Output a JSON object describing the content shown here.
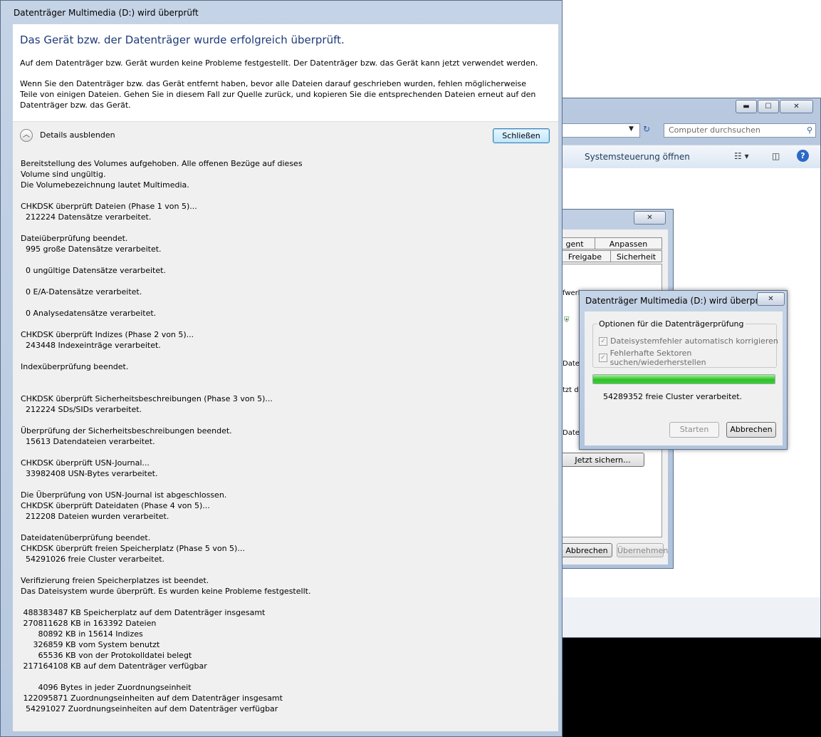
{
  "explorer": {
    "search_placeholder": "Computer durchsuchen",
    "toolbar_label": "Systemsteuerung öffnen",
    "minimize_glyph": "▬",
    "maximize_glyph": "☐",
    "close_glyph": "✕",
    "refresh_glyph": "↻",
    "dropdown_glyph": "▼",
    "search_glyph": "⚲",
    "help_glyph": "?"
  },
  "properties": {
    "tabs_row1": [
      "gent",
      "Anpassen"
    ],
    "tabs_row2": [
      "Freigabe",
      "Sicherheit"
    ],
    "fragments": [
      "fwerk",
      "Dateie",
      "tzt de",
      "Dateie"
    ],
    "check_now_label": "Jetzt sichern...",
    "cancel_label": "Abbrechen",
    "apply_label": "Übernehmen",
    "close_glyph": "✕"
  },
  "small_dialog": {
    "title": "Datenträger Multimedia (D:) wird überprüft",
    "close_glyph": "✕",
    "group_label": "Optionen für die Datenträgerprüfung",
    "options": [
      {
        "label": "Dateisystemfehler automatisch korrigieren",
        "checked": true
      },
      {
        "label": "Fehlerhafte Sektoren suchen/wiederherstellen",
        "checked": true
      }
    ],
    "progress": 1.0,
    "progress_text": "54289352 freie Cluster verarbeitet.",
    "start_label": "Starten",
    "cancel_label": "Abbrechen"
  },
  "main_dialog": {
    "title": "Datenträger Multimedia (D:) wird überprüft",
    "heading": "Das Gerät bzw. der Datenträger wurde erfolgreich überprüft.",
    "paragraph1": "Auf dem Datenträger bzw. Gerät wurden keine Probleme festgestellt. Der Datenträger bzw. das Gerät kann jetzt verwendet werden.",
    "paragraph2": "Wenn Sie den Datenträger bzw. das Gerät entfernt haben, bevor alle Dateien darauf geschrieben wurden, fehlen möglicherweise Teile von einigen Dateien. Gehen Sie in diesem Fall zur Quelle zurück, und kopieren Sie die entsprechenden Dateien erneut auf den Datenträger bzw. das Gerät.",
    "toggle_label": "Details ausblenden",
    "toggle_glyph": "︿",
    "close_button": "Schließen",
    "log": "Bereitstellung des Volumes aufgehoben. Alle offenen Bezüge auf dieses\nVolume sind ungültig.\nDie Volumebezeichnung lautet Multimedia.\n\nCHKDSK überprüft Dateien (Phase 1 von 5)...\n  212224 Datensätze verarbeitet.\n\nDateiüberprüfung beendet.\n  995 große Datensätze verarbeitet.\n\n  0 ungültige Datensätze verarbeitet.\n\n  0 E/A-Datensätze verarbeitet.\n\n  0 Analysedatensätze verarbeitet.\n\nCHKDSK überprüft Indizes (Phase 2 von 5)...\n  243448 Indexeinträge verarbeitet.\n\nIndexüberprüfung beendet.\n\n\nCHKDSK überprüft Sicherheitsbeschreibungen (Phase 3 von 5)...\n  212224 SDs/SIDs verarbeitet.\n\nÜberprüfung der Sicherheitsbeschreibungen beendet.\n  15613 Datendateien verarbeitet.\n\nCHKDSK überprüft USN-Journal...\n  33982408 USN-Bytes verarbeitet.\n\nDie Überprüfung von USN-Journal ist abgeschlossen.\nCHKDSK überprüft Dateidaten (Phase 4 von 5)...\n  212208 Dateien wurden verarbeitet.\n\nDateidatenüberprüfung beendet.\nCHKDSK überprüft freien Speicherplatz (Phase 5 von 5)...\n  54291026 freie Cluster verarbeitet.\n\nVerifizierung freien Speicherplatzes ist beendet.\nDas Dateisystem wurde überprüft. Es wurden keine Probleme festgestellt.\n\n 488383487 KB Speicherplatz auf dem Datenträger insgesamt\n 270811628 KB in 163392 Dateien\n       80892 KB in 15614 Indizes\n     326859 KB vom System benutzt\n       65536 KB von der Protokolldatei belegt\n 217164108 KB auf dem Datenträger verfügbar\n\n       4096 Bytes in jeder Zuordnungseinheit\n 122095871 Zuordnungseinheiten auf dem Datenträger insgesamt\n  54291027 Zuordnungseinheiten auf dem Datenträger verfügbar"
  }
}
